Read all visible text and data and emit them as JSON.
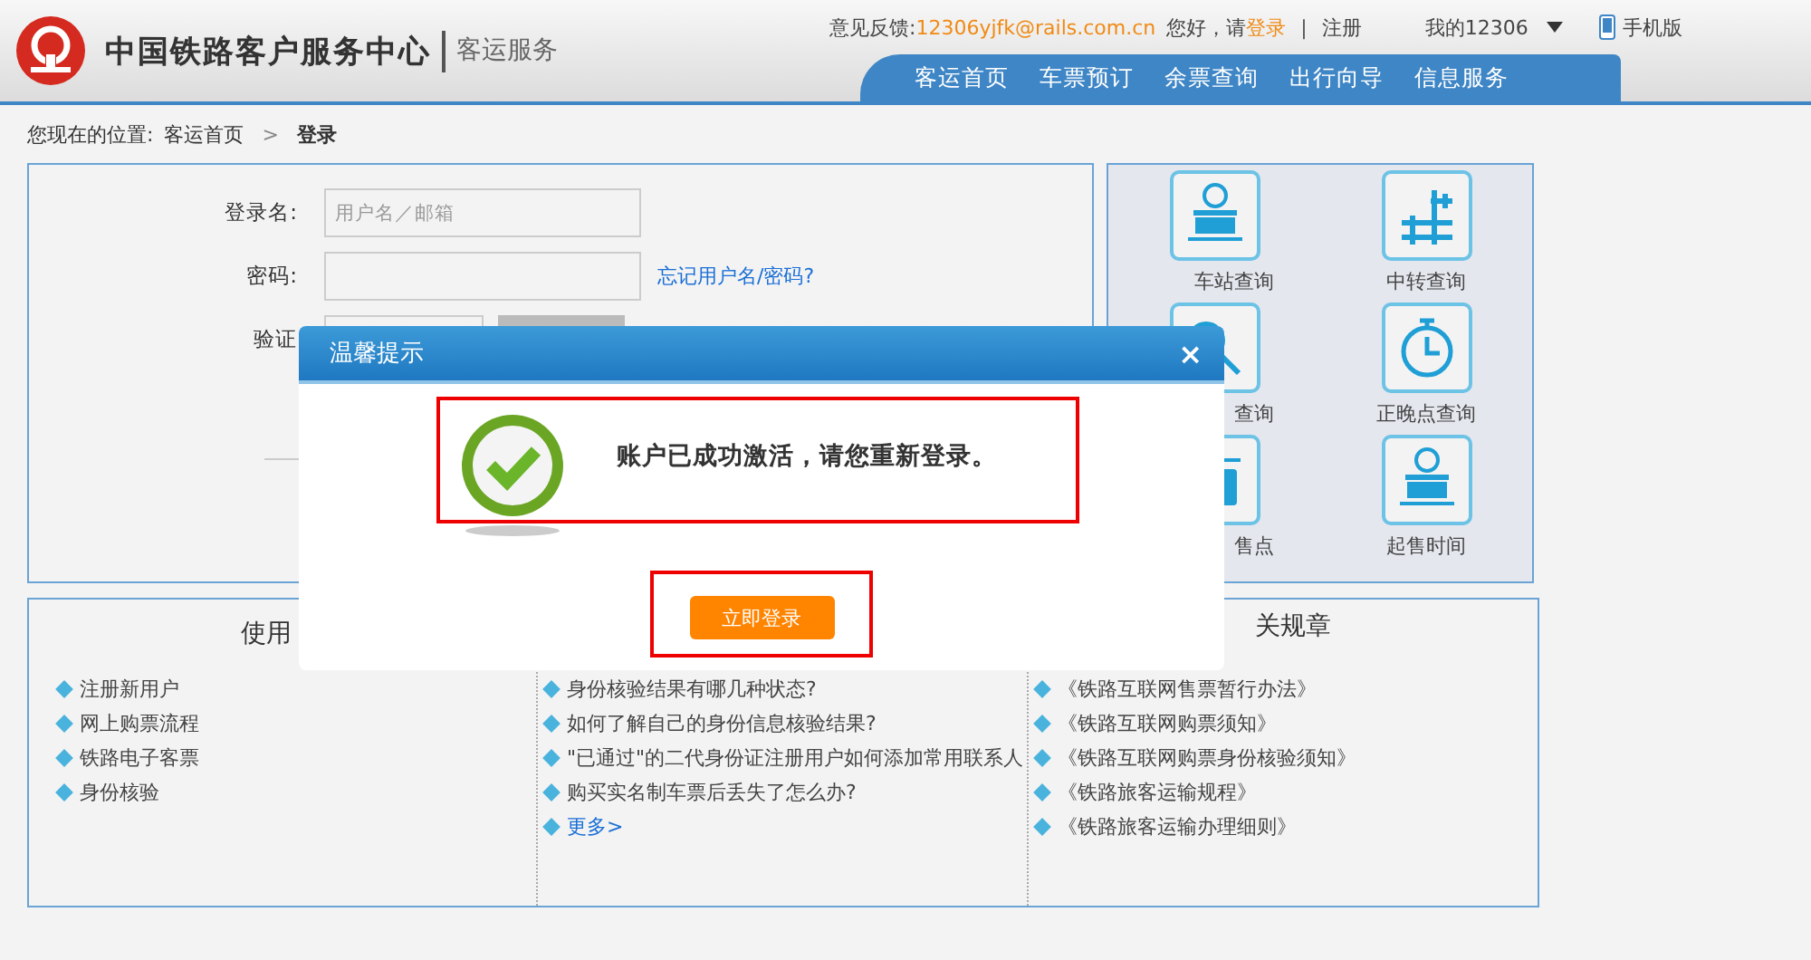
{
  "header": {
    "logo_title": "中国铁路客户服务中心",
    "subtitle": "客运服务",
    "feedback_label": "意见反馈:",
    "feedback_email": "12306yjfk@rails.com.cn",
    "greeting": "您好，请",
    "login_link": "登录",
    "separator": "|",
    "register_link": "注册",
    "my_account": "我的12306",
    "mobile": "手机版"
  },
  "nav": [
    "客运首页",
    "车票预订",
    "余票查询",
    "出行向导",
    "信息服务"
  ],
  "breadcrumb": {
    "label": "您现在的位置:",
    "home": "客运首页",
    "separator": ">",
    "current": "登录"
  },
  "login_form": {
    "fields": [
      {
        "kind": "text",
        "label": "登录名:",
        "placeholder": "用户名／邮箱"
      },
      {
        "kind": "password",
        "label": "密码:"
      },
      {
        "kind": "captcha",
        "label": "验证"
      }
    ],
    "forgot_link": "忘记用户名/密码?"
  },
  "services": [
    "车站查询",
    "中转查询",
    "查询",
    "正晚点查询",
    "售点",
    "起售时间"
  ],
  "sections": [
    {
      "title": "使用",
      "items": [
        "注册新用户",
        "网上购票流程",
        "铁路电子客票",
        "身份核验"
      ]
    },
    {
      "items": [
        "身份核验结果有哪几种状态?",
        "如何了解自己的身份信息核验结果?",
        "\"已通过\"的二代身份证注册用户如何添加常用联系人",
        "购买实名制车票后丢失了怎么办?"
      ],
      "more": "更多>"
    },
    {
      "title": "关规章",
      "items": [
        "《铁路互联网售票暂行办法》",
        "《铁路互联网购票须知》",
        "《铁路互联网购票身份核验须知》",
        "《铁路旅客运输规程》",
        "《铁路旅客运输办理细则》"
      ]
    }
  ],
  "dialog": {
    "title": "温馨提示",
    "close": "×",
    "message": "账户已成功激活，请您重新登录。",
    "button": "立即登录"
  }
}
